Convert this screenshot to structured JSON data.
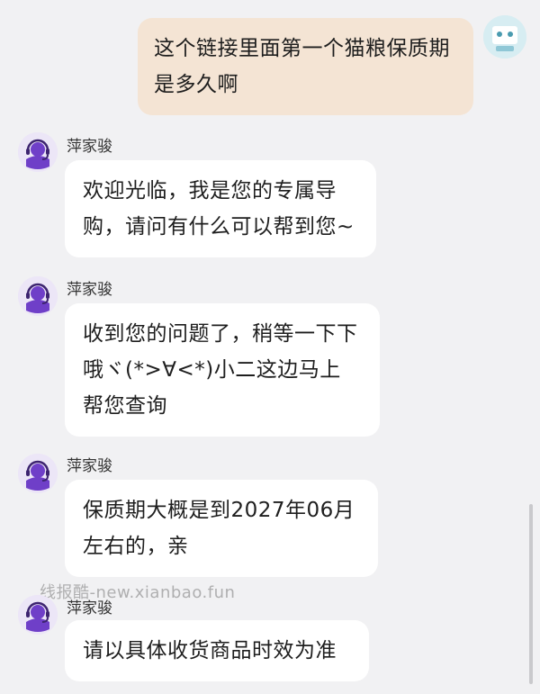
{
  "messages": [
    {
      "direction": "out",
      "text": "这个链接里面第一个猫粮保质期是多久啊"
    },
    {
      "direction": "in",
      "sender": "萍家骏",
      "text": "欢迎光临，我是您的专属导购，请问有什么可以帮到您~"
    },
    {
      "direction": "in",
      "sender": "萍家骏",
      "text": "收到您的问题了，稍等一下下哦ヾ(*>∀<*)小二这边马上帮您查询"
    },
    {
      "direction": "in",
      "sender": "萍家骏",
      "text": "保质期大概是到2027年06月左右的，亲"
    },
    {
      "direction": "in",
      "sender": "萍家骏",
      "text": "请以具体收货商品时效为准"
    }
  ],
  "watermark": "线报酷-new.xianbao.fun",
  "colors": {
    "outgoing_bubble": "#f4e4d4",
    "incoming_bubble": "#ffffff",
    "background": "#f1f1f3",
    "agent_avatar_accent": "#6f3fc8"
  },
  "icons": {
    "agent_avatar": "headset-agent-icon",
    "self_avatar": "user-avatar-icon"
  }
}
